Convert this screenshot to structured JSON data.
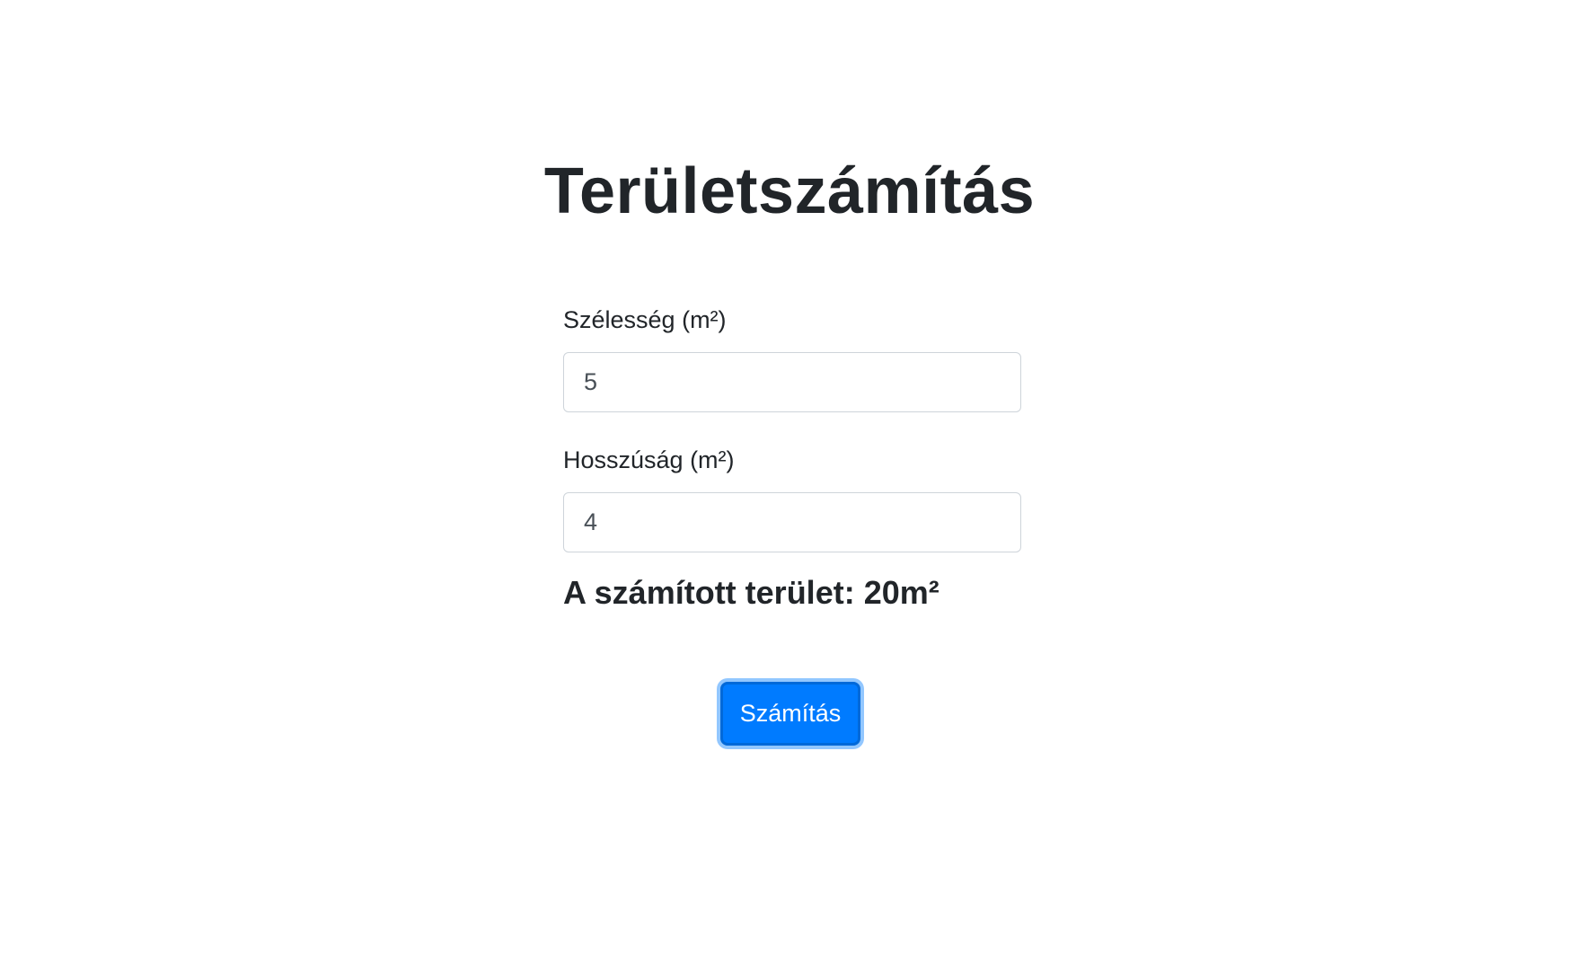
{
  "page": {
    "title": "Területszámítás"
  },
  "form": {
    "width": {
      "label": "Szélesség (m²)",
      "value": "5"
    },
    "length": {
      "label": "Hosszúság (m²)",
      "value": "4"
    }
  },
  "result": {
    "text": "A számított terület: 20m²"
  },
  "actions": {
    "calculate_label": "Számítás"
  },
  "colors": {
    "primary": "#007bff",
    "text": "#212529",
    "input_border": "#ced4da"
  }
}
